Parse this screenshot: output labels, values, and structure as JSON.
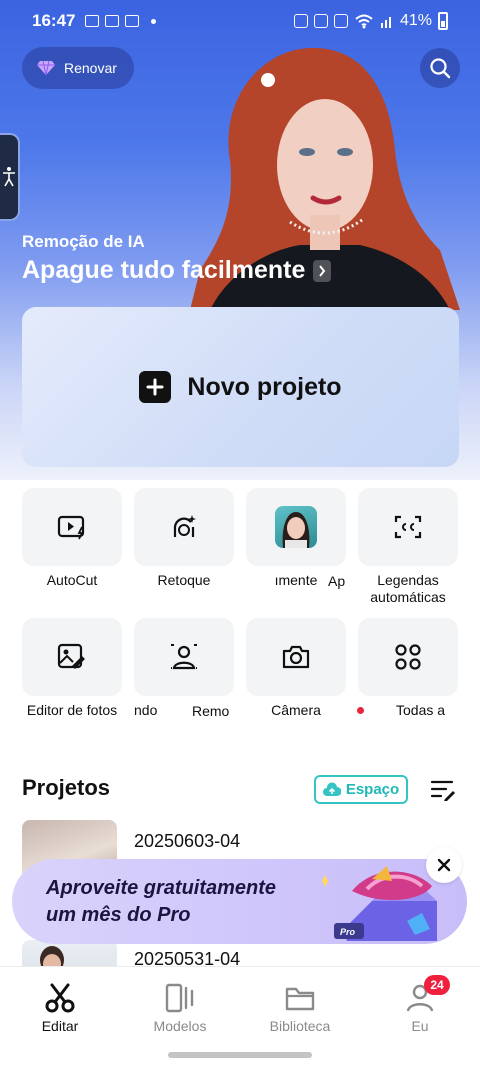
{
  "status_bar": {
    "time": "16:47",
    "battery": "41%"
  },
  "header": {
    "renew_label": "Renovar",
    "hero_subtitle": "Remoção de IA",
    "hero_title": "Apague tudo facilmente"
  },
  "new_project": {
    "label": "Novo projeto"
  },
  "tools_row1": [
    {
      "label": "AutoCut",
      "icon": "autocut-icon"
    },
    {
      "label": "Retoque",
      "icon": "retouch-icon"
    },
    {
      "label": "ımente",
      "icon": "ai-face-thumbnail"
    },
    {
      "label": "Legendas automáticas",
      "icon": "captions-icon"
    }
  ],
  "tools_row1_extra": {
    "label": "Ap"
  },
  "tools_row2": [
    {
      "label": "Editor de fotos",
      "icon": "photo-editor-icon"
    },
    {
      "label": "ndo",
      "icon": "remove-background-icon"
    },
    {
      "label": "Remo",
      "icon": "camera-icon"
    },
    {
      "label": "Câmera",
      "icon": "camera-icon"
    },
    {
      "label": "Todas a",
      "icon": "grid-icon"
    }
  ],
  "projects": {
    "title": "Projetos",
    "space_label": "Espaço",
    "items": [
      {
        "name": "20250603-04"
      },
      {
        "name": "20250531-04"
      }
    ]
  },
  "promo": {
    "line1": "Aproveite gratuitamente",
    "line2": "um mês do Pro",
    "art_label": "Pro"
  },
  "bottom_nav": {
    "items": [
      {
        "label": "Editar"
      },
      {
        "label": "Modelos"
      },
      {
        "label": "Biblioteca"
      },
      {
        "label": "Eu"
      }
    ],
    "badge": "24"
  },
  "colors": {
    "accent": "#35c3c4",
    "badge": "#f0203f",
    "hero_top": "#3b63e0"
  }
}
